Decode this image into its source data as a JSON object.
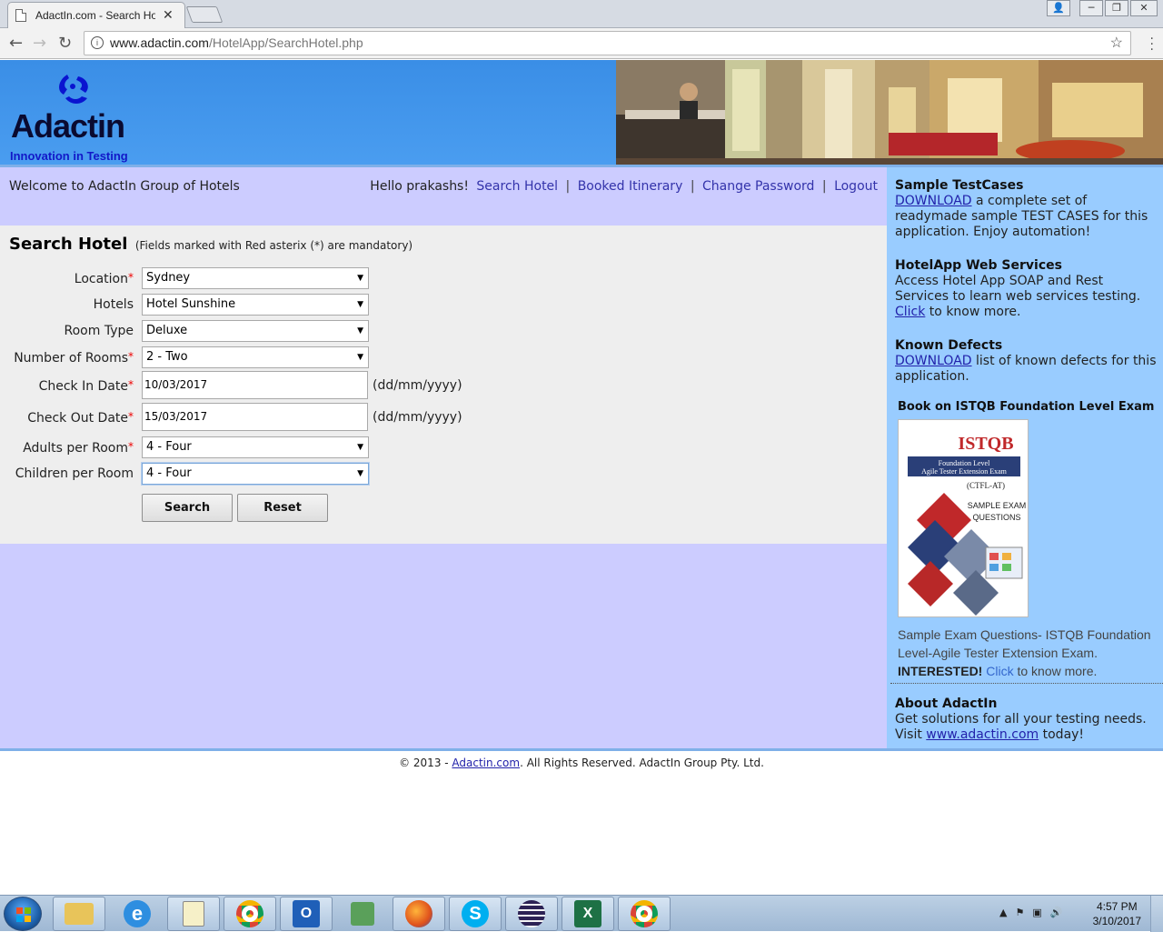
{
  "browser": {
    "tab_title": "AdactIn.com - Search Hotel",
    "tab_close": "✕",
    "url_host": "www.adactin.com",
    "url_path": "/HotelApp/SearchHotel.php",
    "window_buttons": [
      "👤",
      "─",
      "❐",
      "✕"
    ]
  },
  "header": {
    "brand": "Adactin",
    "tagline": "Innovation in Testing"
  },
  "topbar": {
    "welcome": "Welcome to AdactIn Group of Hotels",
    "greeting": "Hello prakashs!",
    "links": [
      "Search Hotel",
      "Booked Itinerary",
      "Change Password",
      "Logout"
    ],
    "separator": "|"
  },
  "form": {
    "title": "Search Hotel",
    "note": "(Fields marked with Red asterix (*) are mandatory)",
    "asterisk": "*",
    "date_format": "(dd/mm/yyyy)",
    "fields": {
      "location": {
        "label": "Location",
        "value": "Sydney"
      },
      "hotels": {
        "label": "Hotels",
        "value": "Hotel Sunshine"
      },
      "room_type": {
        "label": "Room Type",
        "value": "Deluxe"
      },
      "rooms": {
        "label": "Number of Rooms",
        "value": "2 - Two"
      },
      "checkin": {
        "label": "Check In Date",
        "value": "10/03/2017"
      },
      "checkout": {
        "label": "Check Out Date",
        "value": "15/03/2017"
      },
      "adults": {
        "label": "Adults per Room",
        "value": "4 - Four"
      },
      "children": {
        "label": "Children per Room",
        "value": "4 - Four"
      }
    },
    "search_label": "Search",
    "reset_label": "Reset"
  },
  "sidebar": {
    "testcases_title": "Sample TestCases",
    "testcases_link": "DOWNLOAD",
    "testcases_text": " a complete set of readymade sample TEST CASES for this application. Enjoy automation!",
    "ws_title": "HotelApp Web Services",
    "ws_text": "Access Hotel App SOAP and Rest Services to learn web services testing. ",
    "ws_link": "Click",
    "ws_tail": " to know more.",
    "defects_title": "Known Defects",
    "defects_link": "DOWNLOAD",
    "defects_text": " list of known defects for this application.",
    "book_title": "Book on ISTQB Foundation Level Exam",
    "book_cover": {
      "title": "ISTQB",
      "line1": "Foundation Level",
      "line2": "Agile Tester Extension Exam",
      "line3": "(CTFL-AT)",
      "line4": "SAMPLE EXAM",
      "line5": "QUESTIONS"
    },
    "book_desc": "Sample Exam Questions- ISTQB Foundation Level-Agile Tester Extension Exam.",
    "book_interested": "INTERESTED!",
    "book_link": "Click",
    "book_tail": " to know more.",
    "about_title": "About AdactIn",
    "about_text": "Get solutions for all your testing needs. Visit ",
    "about_link": "www.adactin.com",
    "about_tail": " today!"
  },
  "footer": {
    "prefix": "© 2013 - ",
    "link": "Adactin.com",
    "suffix": ". All Rights Reserved. AdactIn Group Pty. Ltd."
  },
  "taskbar": {
    "time": "4:57 PM",
    "date": "3/10/2017"
  },
  "colors": {
    "header_blue": "#4192e6",
    "content_lavender": "#ccccff",
    "sidebar_blue": "#99ccff",
    "link_blue": "#3333aa"
  }
}
